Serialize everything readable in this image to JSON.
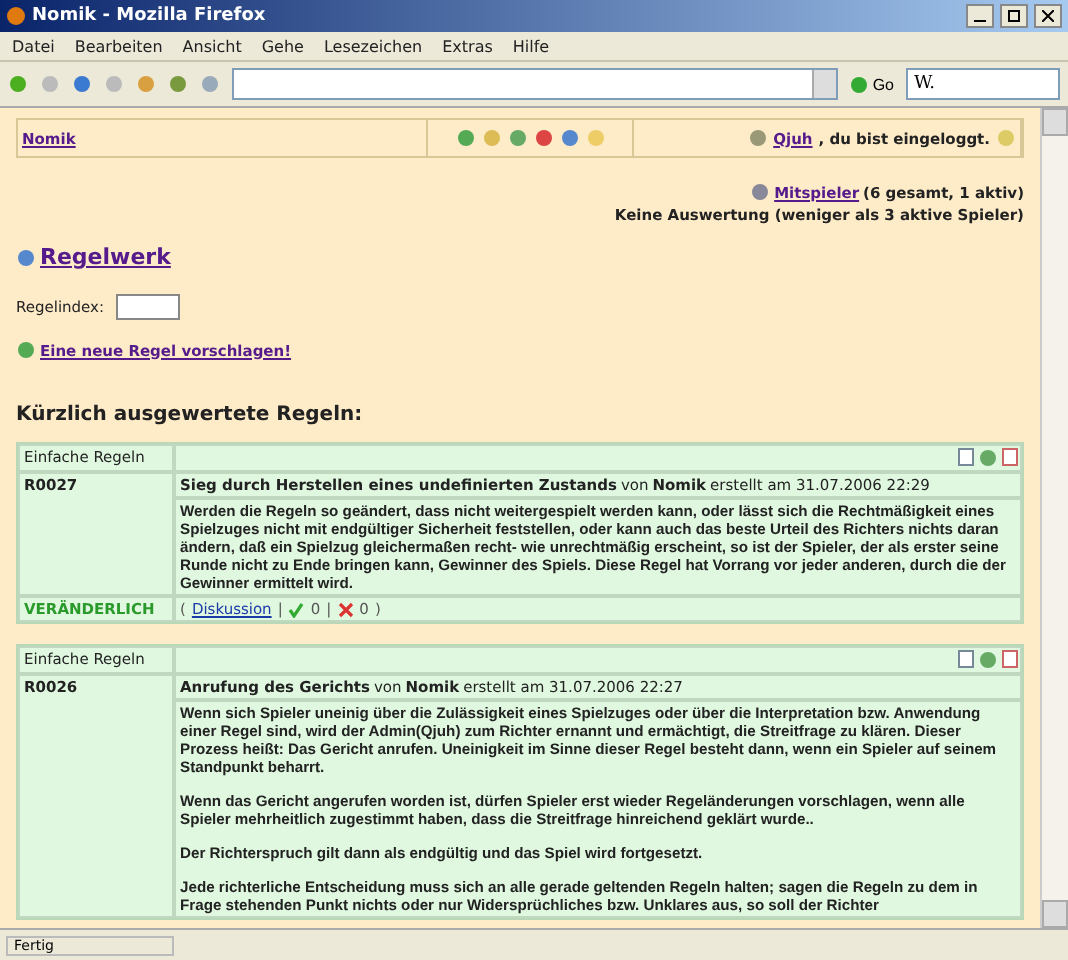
{
  "window": {
    "title": "Nomik - Mozilla Firefox"
  },
  "menu": [
    "Datei",
    "Bearbeiten",
    "Ansicht",
    "Gehe",
    "Lesezeichen",
    "Extras",
    "Hilfe"
  ],
  "toolbar": {
    "go_label": "Go",
    "search_value": "W."
  },
  "header": {
    "site_link": "Nomik",
    "user_link": "Qjuh",
    "logged_in_text": ", du bist eingeloggt."
  },
  "players": {
    "link": "Mitspieler",
    "count": "(6 gesamt, 1 aktiv)",
    "note": "Keine Auswertung (weniger als 3 aktive Spieler)"
  },
  "rules_link": "Regelwerk",
  "rule_index": {
    "label": "Regelindex:"
  },
  "propose_link": "Eine neue Regel vorschlagen!",
  "section_heading": "Kürzlich ausgewertete Regeln:",
  "rules": [
    {
      "category": "Einfache Regeln",
      "id": "R0027",
      "title": "Sieg durch Herstellen eines undefinierten Zustands",
      "by": "von",
      "author": "Nomik",
      "created": "erstellt am 31.07.2006 22:29",
      "paragraphs": [
        "Werden die Regeln so geändert, dass nicht weitergespielt werden kann, oder lässt sich die Rechtmäßigkeit eines Spielzuges nicht mit endgültiger Sicherheit feststellen, oder kann auch das beste Urteil des Richters nichts daran ändern, daß ein Spielzug gleichermaßen recht- wie unrechtmäßig erscheint, so ist der Spieler, der als erster seine Runde nicht zu Ende bringen kann, Gewinner des Spiels. Diese Regel hat Vorrang vor jeder anderen, durch die der Gewinner ermittelt wird."
      ],
      "footer": {
        "status": "VERÄNDERLICH",
        "open": "(",
        "discussion_link": "Diskussion",
        "separator": "|",
        "yes": "0",
        "no": "0",
        "close": ")"
      }
    },
    {
      "category": "Einfache Regeln",
      "id": "R0026",
      "title": "Anrufung des Gerichts",
      "by": "von",
      "author": "Nomik",
      "created": "erstellt am 31.07.2006 22:27",
      "paragraphs": [
        "Wenn sich Spieler uneinig über die Zulässigkeit eines Spielzuges oder über die Interpretation bzw. Anwendung einer Regel sind, wird der Admin(Qjuh) zum Richter ernannt und ermächtigt, die Streitfrage zu klären. Dieser Prozess heißt: Das Gericht anrufen. Uneinigkeit im Sinne dieser Regel besteht dann, wenn ein Spieler auf seinem Standpunkt beharrt.",
        "Wenn das Gericht angerufen worden ist, dürfen Spieler erst wieder Regeländerungen vorschlagen, wenn alle Spieler mehrheitlich zugestimmt haben, dass die Streitfrage hinreichend geklärt wurde..",
        "Der Richterspruch gilt dann als endgültig und das Spiel wird fortgesetzt.",
        "Jede richterliche Entscheidung muss sich an alle gerade geltenden Regeln halten; sagen die Regeln zu dem in Frage stehenden Punkt nichts oder nur Widersprüchliches bzw. Unklares aus, so soll der Richter"
      ]
    }
  ],
  "status_bar": "Fertig"
}
